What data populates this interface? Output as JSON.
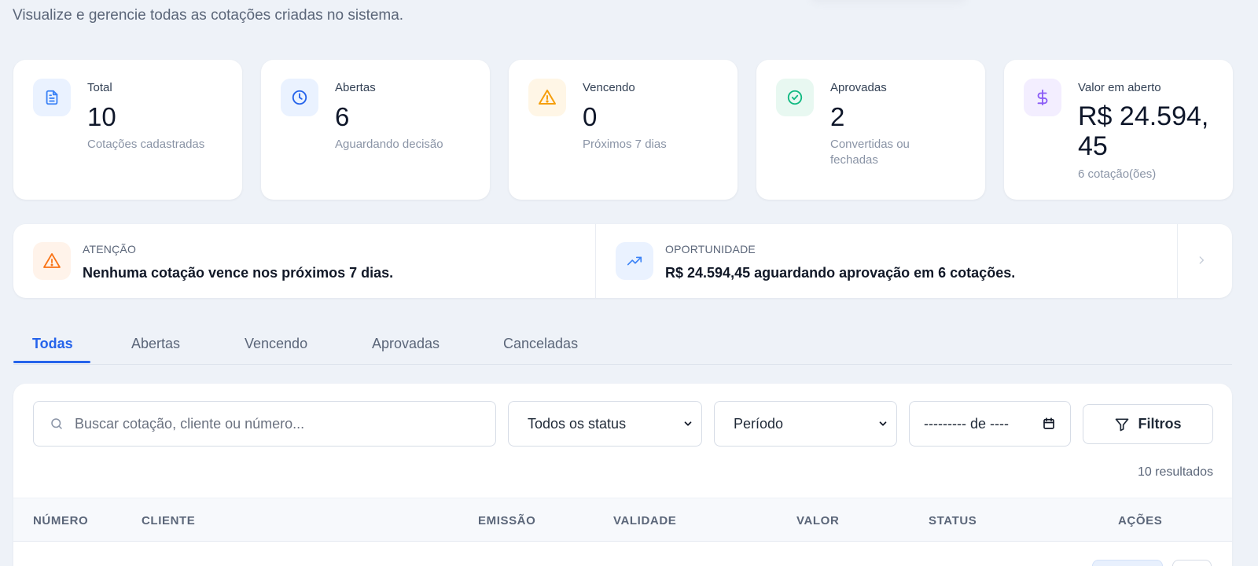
{
  "page": {
    "subtitle": "Visualize e gerencie todas as cotações criadas no sistema."
  },
  "stats": [
    {
      "label": "Total",
      "value": "10",
      "sub": "Cotações cadastradas",
      "icon": "document-icon",
      "color": "#3b82f6",
      "bg": "#eaf2ff"
    },
    {
      "label": "Abertas",
      "value": "6",
      "sub": "Aguardando decisão",
      "icon": "clock-icon",
      "color": "#2563eb",
      "bg": "#eaf2ff"
    },
    {
      "label": "Vencendo",
      "value": "0",
      "sub": "Próximos 7 dias",
      "icon": "warning-icon",
      "color": "#f59e0b",
      "bg": "#fff6e6"
    },
    {
      "label": "Aprovadas",
      "value": "2",
      "sub": "Convertidas ou fechadas",
      "icon": "check-circle-icon",
      "color": "#10b981",
      "bg": "#e8f8f1"
    },
    {
      "label": "Valor em aberto",
      "value": "R$ 24.594,45",
      "sub": "6 cotação(ões)",
      "icon": "dollar-icon",
      "color": "#8b5cf6",
      "bg": "#f3eeff"
    }
  ],
  "alerts": {
    "attention": {
      "kicker": "ATENÇÃO",
      "message": "Nenhuma cotação vence nos próximos 7 dias.",
      "color": "#f97316"
    },
    "opportunity": {
      "kicker": "OPORTUNIDADE",
      "message": "R$ 24.594,45 aguardando aprovação em 6 cotações.",
      "color": "#3b82f6"
    }
  },
  "tabs": [
    {
      "label": "Todas",
      "active": true
    },
    {
      "label": "Abertas"
    },
    {
      "label": "Vencendo"
    },
    {
      "label": "Aprovadas"
    },
    {
      "label": "Canceladas"
    }
  ],
  "filters": {
    "search_placeholder": "Buscar cotação, cliente ou número...",
    "status_selected": "Todos os status",
    "period_selected": "Período",
    "date_value": "--------- de ----",
    "filters_label": "Filtros",
    "results": "10 resultados"
  },
  "table": {
    "columns": [
      "NÚMERO",
      "CLIENTE",
      "EMISSÃO",
      "VALIDADE",
      "VALOR",
      "STATUS",
      "AÇÕES"
    ]
  },
  "colors": {
    "accent": "#2563eb"
  }
}
